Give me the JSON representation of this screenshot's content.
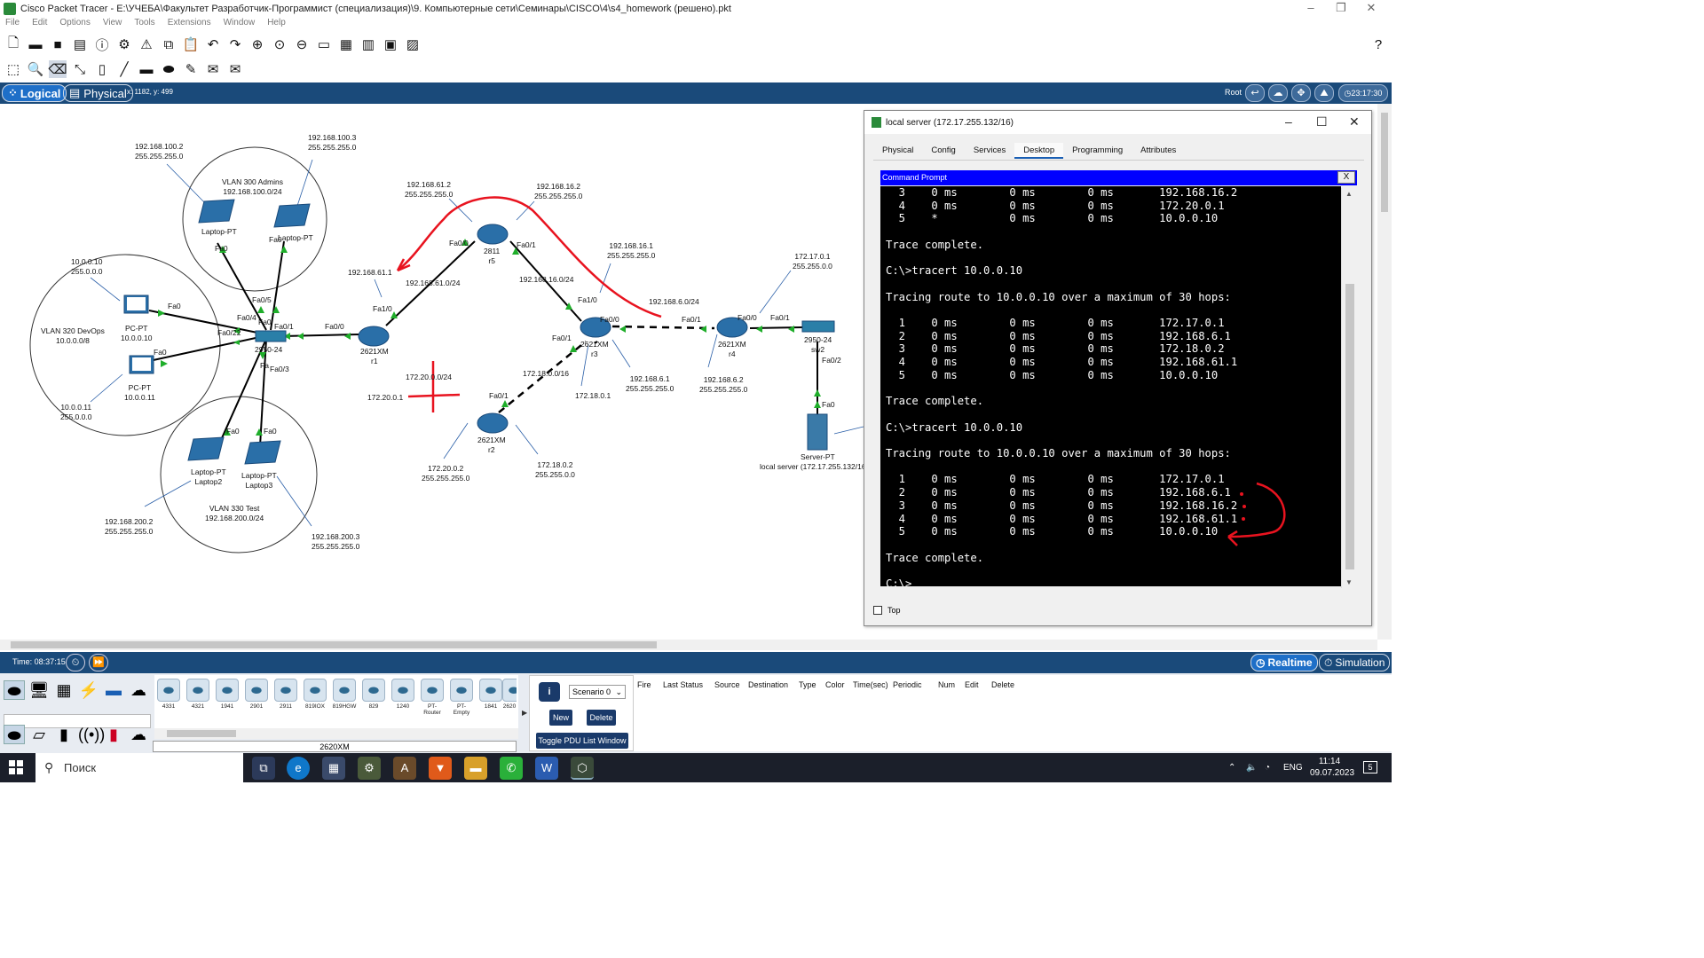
{
  "window": {
    "title": "Cisco Packet Tracer - E:\\УЧЕБА\\Факультет Разработчик-Программист (специализация)\\9. Компьютерные сети\\Семинары\\CISCO\\4\\s4_homework (решено).pkt"
  },
  "menu": [
    "File",
    "Edit",
    "Options",
    "View",
    "Tools",
    "Extensions",
    "Window",
    "Help"
  ],
  "modebar": {
    "logical": "Logical",
    "physical": "Physical",
    "coords": "x: 1182, y: 499",
    "root": "Root",
    "clock": "23:17:30"
  },
  "topology": {
    "labels": {
      "pc0_ip": "10.0.0.10",
      "pc0_mask": "255.0.0.0",
      "pc1_ip": "10.0.0.11",
      "pc1_mask": "255.0.0.0",
      "lap0_ip": "192.168.100.2",
      "lap0_mask": "255.255.255.0",
      "lap1_ip": "192.168.100.3",
      "lap1_mask": "255.255.255.0",
      "lap2_ip": "192.168.200.2",
      "lap2_mask": "255.255.255.0",
      "lap3_ip": "192.168.200.3",
      "lap3_mask": "255.255.255.0",
      "vlan300": "VLAN 300 Admins",
      "vlan300_net": "192.168.100.0/24",
      "vlan320": "VLAN 320 DevOps",
      "vlan320_net": "10.0.0.0/8",
      "vlan330": "VLAN 330 Test",
      "vlan330_net": "192.168.200.0/24",
      "r5_fa00_ip": "192.168.61.2",
      "r5_fa00_mask": "255.255.255.0",
      "r5_fa01_ip": "192.168.16.2",
      "r5_fa01_mask": "255.255.255.0",
      "r3_fa10_ip": "192.168.16.1",
      "r3_fa10_mask": "255.255.255.0",
      "r1_fa10_ip": "192.168.61.1",
      "net_61": "192.168.61.0/24",
      "net_16": "192.168.16.0/24",
      "net_6": "192.168.6.0/24",
      "net_20": "172.20.0.0/24",
      "net_18": "172.18.0.0/16",
      "r1_fa01_ip": "172.20.0.1",
      "r3_fa01_ip": "172.18.0.1",
      "r3_fa00_ip": "192.168.6.1",
      "r3_fa00_mask": "255.255.255.0",
      "r4_fa01_ip": "192.168.6.2",
      "r4_fa01_mask": "255.255.255.0",
      "r4_fa00_ip": "172.17.0.1",
      "r4_fa00_mask": "255.255.0.0",
      "r2_fa01_ip": "172.18.0.2",
      "r2_fa01_mask": "255.255.0.0",
      "r2_fa00_ip": "172.20.0.2",
      "r2_fa00_mask": "255.255.255.0"
    },
    "devices": {
      "pc0": [
        "PC-PT",
        "10.0.0.10"
      ],
      "pc1": [
        "PC-PT",
        "10.0.0.11"
      ],
      "laptop0": [
        "Laptop-PT",
        "Laptop0"
      ],
      "laptop1": [
        "Laptop-PT",
        "Laptop1"
      ],
      "laptop2": [
        "Laptop-PT",
        "Laptop2"
      ],
      "laptop3": [
        "Laptop-PT",
        "Laptop3"
      ],
      "sw1": [
        "2950-24",
        "sw1"
      ],
      "r1": [
        "2621XM",
        "r1"
      ],
      "r5": [
        "2811",
        "r5"
      ],
      "r3": [
        "2621XM",
        "r3"
      ],
      "r2": [
        "2621XM",
        "r2"
      ],
      "r4": [
        "2621XM",
        "r4"
      ],
      "sw2": [
        "2950-24",
        "sw2"
      ],
      "server": [
        "Server-PT",
        "local server (172.17.255.132/16)"
      ]
    },
    "ports": {
      "p1": "Fa0",
      "p2": "Fa0",
      "p3": "Fa0",
      "p4": "Fa0",
      "p5": "Fa0",
      "p6": "Fa0",
      "p7": "Fa0/5",
      "p8": "Fa0/4",
      "p9": "Fa0/22",
      "p10": "Fa0/23",
      "p11": "Fa0/1",
      "p12": "Fa0/3",
      "p13": "Fa0/2",
      "p14": "Fa0/0",
      "p15": "Fa1/0",
      "p16": "Fa0/0",
      "p17": "Fa0/1",
      "p18": "Fa1/0",
      "p19": "Fa0/0",
      "p20": "Fa0/1",
      "p21": "Fa0/1",
      "p22": "Fa0/0",
      "p23": "Fa0/1",
      "p24": "Fa0/2",
      "p25": "Fa0",
      "p26": "Fa0/1"
    }
  },
  "device_window": {
    "title": "local server (172.17.255.132/16)",
    "tabs": [
      "Physical",
      "Config",
      "Services",
      "Desktop",
      "Programming",
      "Attributes"
    ],
    "active_tab": "Desktop",
    "panel_title": "Command Prompt",
    "close_label": "X",
    "terminal": "  3    0 ms        0 ms        0 ms       192.168.16.2\n  4    0 ms        0 ms        0 ms       172.20.0.1\n  5    *           0 ms        0 ms       10.0.0.10\n\nTrace complete.\n\nC:\\>tracert 10.0.0.10\n\nTracing route to 10.0.0.10 over a maximum of 30 hops:\n\n  1    0 ms        0 ms        0 ms       172.17.0.1\n  2    0 ms        0 ms        0 ms       192.168.6.1\n  3    0 ms        0 ms        0 ms       172.18.0.2\n  4    0 ms        0 ms        0 ms       192.168.61.1\n  5    0 ms        0 ms        0 ms       10.0.0.10\n\nTrace complete.\n\nC:\\>tracert 10.0.0.10\n\nTracing route to 10.0.0.10 over a maximum of 30 hops:\n\n  1    0 ms        0 ms        0 ms       172.17.0.1\n  2    0 ms        0 ms        0 ms       192.168.6.1\n  3    0 ms        0 ms        0 ms       192.168.16.2\n  4    0 ms        0 ms        0 ms       192.168.61.1\n  5    0 ms        0 ms        0 ms       10.0.0.10\n\nTrace complete.\n\nC:\\>",
    "top_checkbox": "Top"
  },
  "simbar": {
    "time": "Time: 08:37:15",
    "realtime": "Realtime",
    "simulation": "Simulation"
  },
  "palette": {
    "models": [
      "4331",
      "4321",
      "1941",
      "2901",
      "2911",
      "819IOX",
      "819HGW",
      "829",
      "1240",
      "PT-Router",
      "PT-Empty",
      "1841",
      "2620"
    ],
    "selected_model": "2620XM"
  },
  "scenario": {
    "select": "Scenario 0",
    "new": "New",
    "delete": "Delete",
    "toggle": "Toggle PDU List Window"
  },
  "pdu_headers": [
    "Fire",
    "Last Status",
    "Source",
    "Destination",
    "Type",
    "Color",
    "Time(sec)",
    "Periodic",
    "Num",
    "Edit",
    "Delete"
  ],
  "taskbar": {
    "search": "Поиск",
    "lang": "ENG",
    "time": "11:14",
    "date": "09.07.2023",
    "notif": "5"
  },
  "colors": {
    "accent": "#1a4a7a",
    "link_green": "#1fae2a",
    "annotation_red": "#e8131f",
    "cmd_blue": "#0000ff"
  }
}
